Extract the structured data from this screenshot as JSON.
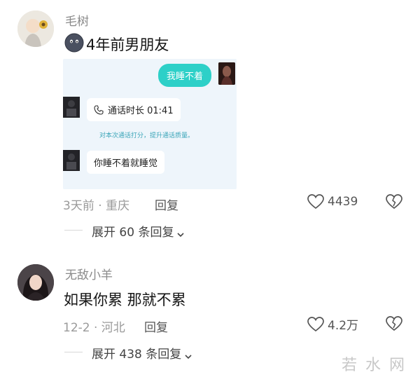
{
  "comments": [
    {
      "username": "毛树",
      "text": "4年前男朋友",
      "chat": {
        "outgoing": "我睡不着",
        "call_label": "通话时长 01:41",
        "system_note": "对本次通话打分，提升通话质量。",
        "incoming": "你睡不着就睡觉"
      },
      "meta": "3天前 · 重庆",
      "reply_label": "回复",
      "likes": "4439",
      "expand_label": "展开 60 条回复"
    },
    {
      "username": "无敌小羊",
      "text": "如果你累 那就不累",
      "meta": "12-2 · 河北",
      "reply_label": "回复",
      "likes": "4.2万",
      "expand_label": "展开 438 条回复"
    }
  ],
  "watermark": "若水网",
  "colors": {
    "accent_bubble": "#2dd0c8",
    "chat_background": "#eef5fb",
    "system_note": "#3aa5b8"
  }
}
